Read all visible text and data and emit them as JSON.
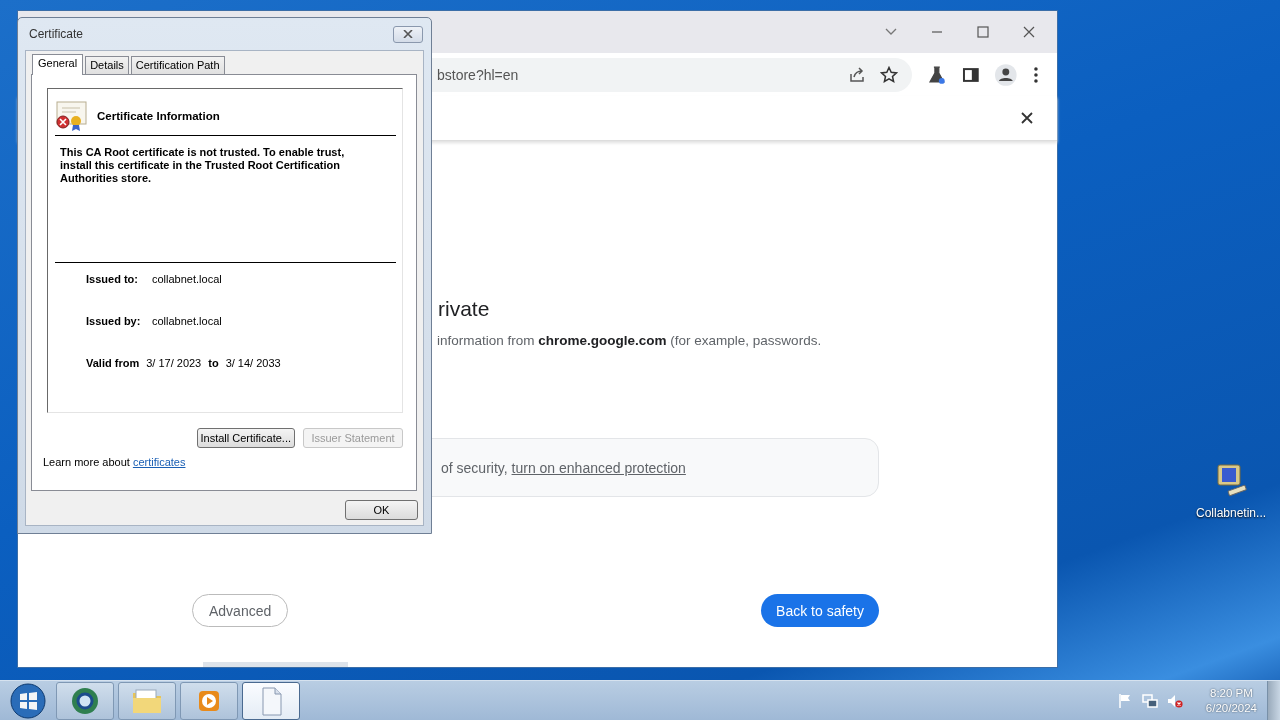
{
  "desktop": {
    "icons": [
      {
        "label": "Collabnetin..."
      }
    ]
  },
  "browser": {
    "address": "bstore?hl=en",
    "heading": "rivate",
    "body": "information from **chrome.google.com** (for example, passwords.",
    "notice": {
      "text": "of security, ",
      "link": "turn on enhanced protection"
    },
    "buttons": [
      {
        "label": "Advanced",
        "kind": "secondary"
      },
      {
        "label": "Back to safety",
        "kind": "primary"
      }
    ]
  },
  "dialog": {
    "title": "Certificate",
    "tabs": [
      {
        "label": "General",
        "selected": true
      },
      {
        "label": "Details",
        "selected": false
      },
      {
        "label": "Certification Path",
        "selected": false
      }
    ],
    "info_title": "Certificate Information",
    "message": "This CA Root certificate is not trusted. To enable trust, install this certificate in the Trusted Root Certification Authorities store.",
    "fields": [
      {
        "label": "Issued to:",
        "value": "collabnet.local"
      },
      {
        "label": "Issued by:",
        "value": "collabnet.local"
      }
    ],
    "valid": {
      "label": "Valid from",
      "from": "3/ 17/ 2023",
      "to_label": "to",
      "to": "3/ 14/ 2033"
    },
    "buttons": [
      {
        "label": "Install Certificate...",
        "disabled": false
      },
      {
        "label": "Issuer Statement",
        "disabled": true
      }
    ],
    "learn_more": {
      "text": "Learn more about ",
      "link": "certificates"
    },
    "ok": "OK"
  },
  "taskbar": {
    "items": [
      {
        "kind": "browser",
        "selected": false
      },
      {
        "kind": "folder",
        "selected": false
      },
      {
        "kind": "media",
        "selected": false
      },
      {
        "kind": "document",
        "selected": true
      }
    ],
    "clock": {
      "time": "8:20 PM",
      "date": "6/20/2024"
    }
  }
}
